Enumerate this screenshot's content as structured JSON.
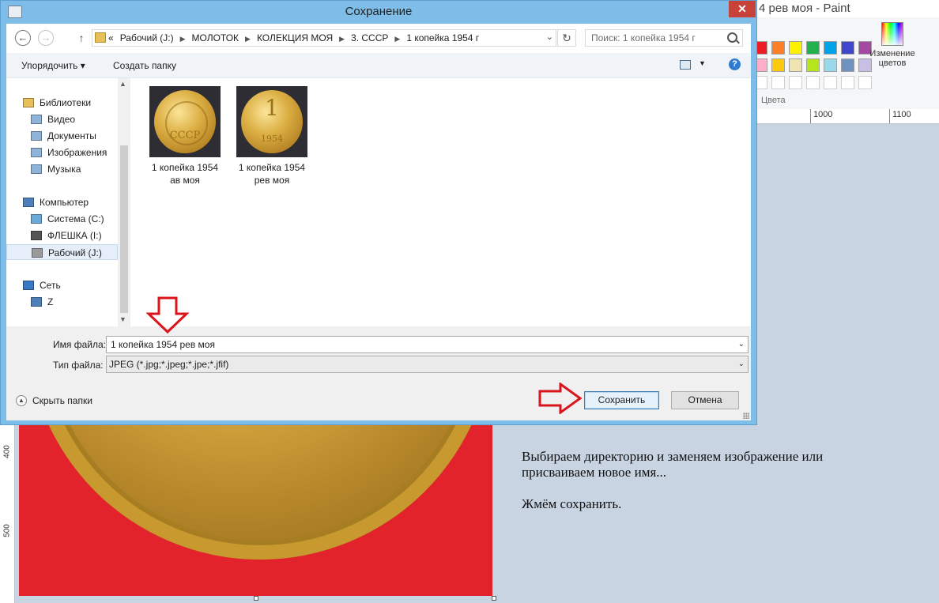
{
  "paint": {
    "window_title": "4 рев моя - Paint",
    "colors_label": "Цвета",
    "edit_colors_label": "Изменение цветов",
    "palette_row1": [
      "#ed1c24",
      "#ff7f27",
      "#fff200",
      "#22b14c",
      "#00a2e8",
      "#3f48cc",
      "#a349a4"
    ],
    "palette_row2": [
      "#ffaec9",
      "#ffc90e",
      "#efe4b0",
      "#b5e61d",
      "#99d9ea",
      "#7092be",
      "#c8bfe7"
    ],
    "ruler_top": [
      "1000",
      "1100"
    ],
    "ruler_left": [
      "400",
      "500"
    ],
    "instructions": [
      "Выбираем директорию и заменяем изображение или присваиваем новое имя...",
      "Жмём сохранить."
    ]
  },
  "dialog": {
    "title": "Сохранение",
    "close_glyph": "✕",
    "breadcrumb": [
      "«",
      "Рабочий (J:)",
      "МОЛОТОК",
      "КОЛЕКЦИЯ МОЯ",
      "3. СССР",
      "1 копейка 1954 г"
    ],
    "search_placeholder": "Поиск: 1 копейка 1954 г",
    "toolbar": {
      "organize_label": "Упорядочить ▾",
      "new_folder_label": "Создать папку",
      "help_glyph": "?"
    },
    "nav_tree": [
      {
        "label": "Библиотеки",
        "icon": "libraries-icon",
        "indent": 0
      },
      {
        "label": "Видео",
        "icon": "video-library-icon",
        "indent": 1
      },
      {
        "label": "Документы",
        "icon": "documents-library-icon",
        "indent": 1
      },
      {
        "label": "Изображения",
        "icon": "pictures-library-icon",
        "indent": 1
      },
      {
        "label": "Музыка",
        "icon": "music-library-icon",
        "indent": 1
      },
      {
        "label": "Компьютер",
        "icon": "computer-icon",
        "indent": 0
      },
      {
        "label": "Система (C:)",
        "icon": "system-drive-icon",
        "indent": 1
      },
      {
        "label": "ФЛЕШКА (I:)",
        "icon": "usb-drive-icon",
        "indent": 1
      },
      {
        "label": "Рабочий (J:)",
        "icon": "hard-drive-icon",
        "indent": 1,
        "selected": true
      },
      {
        "label": "Сеть",
        "icon": "network-icon",
        "indent": 0
      },
      {
        "label": "Z",
        "icon": "network-computer-icon",
        "indent": 1
      }
    ],
    "files": [
      {
        "name_line1": "1 копейка 1954",
        "name_line2": "ав моя",
        "coin_text1": "СССР",
        "coin_text2": ""
      },
      {
        "name_line1": "1 копейка 1954",
        "name_line2": "рев моя",
        "coin_text1": "1",
        "coin_text2": "1954"
      }
    ],
    "filename_label": "Имя файла:",
    "filename_value": "1 копейка 1954 рев моя",
    "filetype_label": "Тип файла:",
    "filetype_value": "JPEG (*.jpg;*.jpeg;*.jpe;*.jfif)",
    "hide_folders_label": "Скрыть папки",
    "save_label": "Сохранить",
    "cancel_label": "Отмена"
  },
  "colors": {
    "dialog_frame": "#7fbde9",
    "annotation_arrow": "#d9141c",
    "canvas_background": "#e3232c"
  }
}
